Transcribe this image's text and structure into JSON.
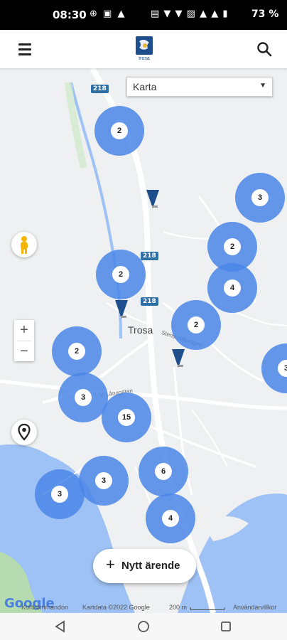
{
  "status_bar": {
    "time": "08:30",
    "left_icons": "⊕ ▣ ▲",
    "right_icons": "▤ ▼ ▼ ▨ ▲ ▲ ▮",
    "battery": "73 %"
  },
  "app_bar": {
    "logo_text": "trosa"
  },
  "map_type": {
    "selected": "Karta"
  },
  "map": {
    "town_label": "Trosa",
    "road_labels": [
      "218",
      "218",
      "218"
    ],
    "street_labels": [
      "Stensundsvägen",
      "V. Långgatan"
    ],
    "clusters": [
      {
        "count": "2"
      },
      {
        "count": "3"
      },
      {
        "count": "2"
      },
      {
        "count": "2"
      },
      {
        "count": "4"
      },
      {
        "count": "2"
      },
      {
        "count": "2"
      },
      {
        "count": "3"
      },
      {
        "count": "3"
      },
      {
        "count": "15"
      },
      {
        "count": "6"
      },
      {
        "count": "3"
      },
      {
        "count": "3"
      },
      {
        "count": "4"
      }
    ]
  },
  "zoom": {
    "plus": "+",
    "minus": "−"
  },
  "fab": {
    "icon": "+",
    "label": "Nytt ärende"
  },
  "attribution": {
    "logo": "Google",
    "shortcuts": "Kortkommandon",
    "map_data": "Kartdata ©2022 Google",
    "scale": "200 m",
    "terms": "Användarvillkor"
  },
  "colors": {
    "cluster": "#4a86e8",
    "pin": "#1f4e8c",
    "water": "#9ec2f5",
    "road_badge": "#2e6fa6"
  }
}
